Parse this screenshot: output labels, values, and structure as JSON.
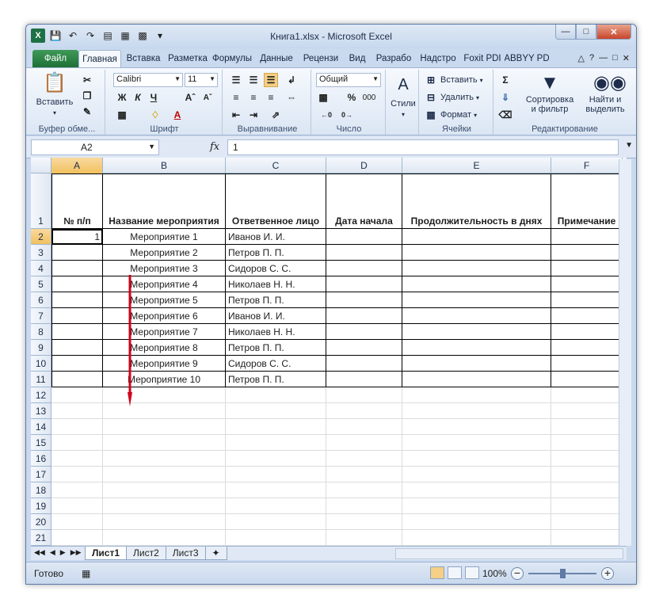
{
  "window": {
    "title": "Книга1.xlsx  -  Microsoft Excel"
  },
  "ribbon_tabs": [
    "Файл",
    "Главная",
    "Вставка",
    "Разметка",
    "Формулы",
    "Данные",
    "Рецензи",
    "Вид",
    "Разрабо",
    "Надстро",
    "Foxit PDI",
    "ABBYY PD"
  ],
  "active_tab": "Главная",
  "clipboard": {
    "paste_label": "Вставить",
    "group_label": "Буфер обме..."
  },
  "font": {
    "name": "Calibri",
    "size": "11",
    "group_label": "Шрифт"
  },
  "alignment": {
    "group_label": "Выравнивание"
  },
  "number": {
    "format": "Общий",
    "group_label": "Число",
    "percent": "%",
    "thousands": "000"
  },
  "styles": {
    "label": "Стили"
  },
  "cells": {
    "insert": "Вставить",
    "delete": "Удалить",
    "format": "Формат",
    "group_label": "Ячейки"
  },
  "editing": {
    "sort_line1": "Сортировка",
    "sort_line2": "и фильтр",
    "find_line1": "Найти и",
    "find_line2": "выделить",
    "group_label": "Редактирование"
  },
  "formula_bar": {
    "name_box": "A2",
    "fx": "fx",
    "value": "1"
  },
  "columns": [
    "A",
    "B",
    "C",
    "D",
    "E",
    "F"
  ],
  "selected_column": "A",
  "selected_row": "2",
  "table": {
    "headers": [
      "№ п/п",
      "Название мероприятия",
      "Ответвенное лицо",
      "Дата начала",
      "Продолжительность в днях",
      "Примечание"
    ],
    "rows": [
      {
        "num": "1",
        "event": "Мероприятие 1",
        "person": "Иванов И. И."
      },
      {
        "num": "",
        "event": "Мероприятие 2",
        "person": "Петров П. П."
      },
      {
        "num": "",
        "event": "Мероприятие 3",
        "person": "Сидоров С. С."
      },
      {
        "num": "",
        "event": "Мероприятие 4",
        "person": "Николаев Н. Н."
      },
      {
        "num": "",
        "event": "Мероприятие 5",
        "person": "Петров П. П."
      },
      {
        "num": "",
        "event": "Мероприятие 6",
        "person": "Иванов И. И."
      },
      {
        "num": "",
        "event": "Мероприятие 7",
        "person": "Николаев Н. Н."
      },
      {
        "num": "",
        "event": "Мероприятие 8",
        "person": "Петров П. П."
      },
      {
        "num": "",
        "event": "Мероприятие 9",
        "person": "Сидоров С. С."
      },
      {
        "num": "",
        "event": "Мероприятие 10",
        "person": "Петров П. П."
      }
    ]
  },
  "row_numbers": [
    "1",
    "2",
    "3",
    "4",
    "5",
    "6",
    "7",
    "8",
    "9",
    "10",
    "11",
    "12",
    "13",
    "14",
    "15",
    "16",
    "17",
    "18",
    "19",
    "20",
    "21"
  ],
  "sheet_tabs": [
    "Лист1",
    "Лист2",
    "Лист3"
  ],
  "active_sheet": "Лист1",
  "status": {
    "ready": "Готово",
    "zoom": "100%"
  },
  "colors": {
    "accent_file_tab": "#1d6f36",
    "selection_header": "#f1c15f",
    "drag_arrow": "#d0021b"
  }
}
